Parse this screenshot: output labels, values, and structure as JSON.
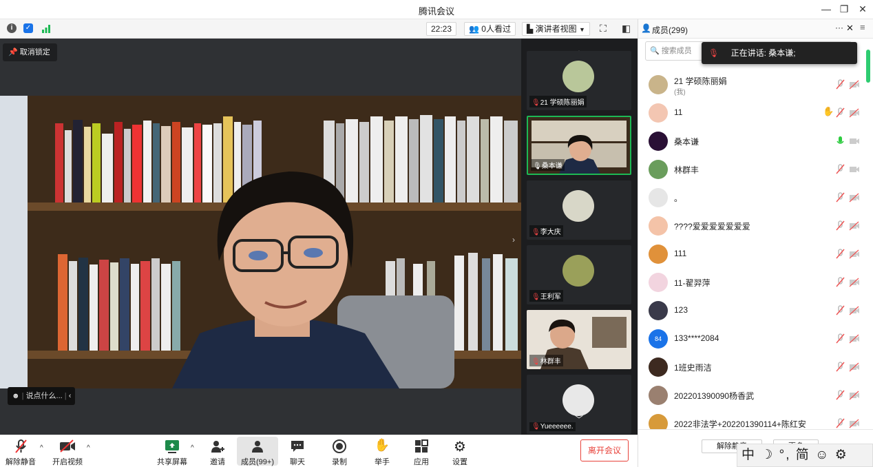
{
  "window": {
    "title": "腾讯会议"
  },
  "topbar": {
    "time": "22:23",
    "viewers": "0人看过",
    "view_mode": "演讲者视图"
  },
  "stage": {
    "unlock_label": "取消锁定",
    "chat_placeholder": "说点什么..."
  },
  "thumbnails": [
    {
      "label": "21 学硕陈丽娟"
    },
    {
      "label": "桑本谦"
    },
    {
      "label": "李大庆"
    },
    {
      "label": "王利军"
    },
    {
      "label": "林群丰"
    },
    {
      "label": "Yueeeeee."
    }
  ],
  "toolbar": {
    "unmute": "解除静音",
    "start_video": "开启视频",
    "share": "共享屏幕",
    "invite": "邀请",
    "members": "成员(99+)",
    "chat": "聊天",
    "record": "录制",
    "raise_hand": "举手",
    "apps": "应用",
    "settings": "设置",
    "leave": "离开会议"
  },
  "panel": {
    "title": "成员(299)",
    "more": "···",
    "search_placeholder": "搜索成员",
    "speaking": "正在讲话: 桑本谦;",
    "members": [
      {
        "name": "21 学硕陈丽娟",
        "sub": "(我)",
        "color": "#c9b48a"
      },
      {
        "name": "11",
        "color": "#f3c6b2"
      },
      {
        "name": "桑本谦",
        "color": "#2a1035"
      },
      {
        "name": "林群丰",
        "color": "#6a9d5c"
      },
      {
        "name": "。",
        "color": "#e6e6e6"
      },
      {
        "name": "????爱爱爱爱爱爱爱",
        "color": "#f4c3a8"
      },
      {
        "name": "111",
        "color": "#e0913a"
      },
      {
        "name": "11-翟羿萍",
        "color": "#f2d4df"
      },
      {
        "name": "123",
        "color": "#3a3a4a"
      },
      {
        "name": "133****2084",
        "avatar_text": "84",
        "color": "#1a73e8"
      },
      {
        "name": "1班史雨洁",
        "color": "#3d2a20"
      },
      {
        "name": "202201390090杨香武",
        "color": "#9a8070"
      },
      {
        "name": "2022非法学+202201390114+陈红安",
        "color": "#d79a3a"
      }
    ],
    "unmute_all": "解除静音",
    "more_btn": "更多"
  },
  "ime": {
    "text": "中 ☽ °, 简 ☺ ⚙"
  }
}
